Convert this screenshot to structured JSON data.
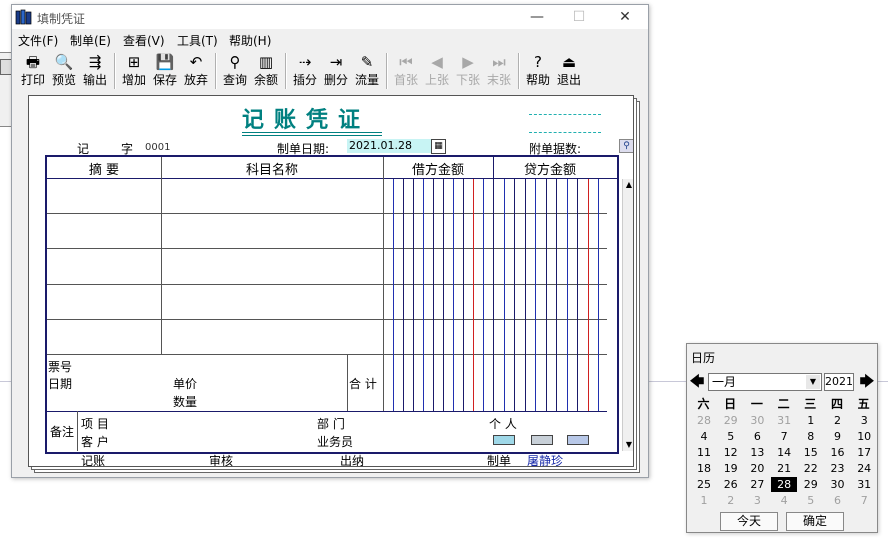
{
  "window": {
    "title": "填制凭证",
    "controls": {
      "minimize": "—",
      "maximize": "☐",
      "close": "✕"
    }
  },
  "menu": [
    "文件(F)",
    "制单(E)",
    "查看(V)",
    "工具(T)",
    "帮助(H)"
  ],
  "toolbar": [
    {
      "label": "打印",
      "icon": "printer-icon",
      "glyph": "🖶",
      "enabled": true
    },
    {
      "label": "预览",
      "icon": "preview-icon",
      "glyph": "🔍",
      "enabled": true
    },
    {
      "label": "输出",
      "icon": "export-icon",
      "glyph": "⇶",
      "enabled": true
    },
    {
      "label": "增加",
      "icon": "add-icon",
      "glyph": "⊞",
      "enabled": true
    },
    {
      "label": "保存",
      "icon": "save-icon",
      "glyph": "💾",
      "enabled": true
    },
    {
      "label": "放弃",
      "icon": "undo-icon",
      "glyph": "↶",
      "enabled": true
    },
    {
      "label": "查询",
      "icon": "binoculars-icon",
      "glyph": "⚲",
      "enabled": true
    },
    {
      "label": "余额",
      "icon": "balance-chart-icon",
      "glyph": "▥",
      "enabled": true
    },
    {
      "label": "插分",
      "icon": "insert-line-icon",
      "glyph": "⇢",
      "enabled": true
    },
    {
      "label": "删分",
      "icon": "delete-line-icon",
      "glyph": "⇥",
      "enabled": true
    },
    {
      "label": "流量",
      "icon": "cashflow-icon",
      "glyph": "✎",
      "enabled": true
    },
    {
      "label": "首张",
      "icon": "first-icon",
      "glyph": "⏮",
      "enabled": false
    },
    {
      "label": "上张",
      "icon": "prev-icon",
      "glyph": "◀",
      "enabled": false
    },
    {
      "label": "下张",
      "icon": "next-icon",
      "glyph": "▶",
      "enabled": false
    },
    {
      "label": "末张",
      "icon": "last-icon",
      "glyph": "⏭",
      "enabled": false
    },
    {
      "label": "帮助",
      "icon": "help-icon",
      "glyph": "?",
      "enabled": true
    },
    {
      "label": "退出",
      "icon": "exit-icon",
      "glyph": "⏏",
      "enabled": true
    }
  ],
  "voucher": {
    "title": "记账凭证",
    "type_label": "记",
    "number_label": "字",
    "number": "0001",
    "date_label": "制单日期:",
    "date": "2021.01.28",
    "attachments_label": "附单据数:",
    "headers": {
      "summary": "摘  要",
      "account": "科目名称",
      "debit": "借方金额",
      "credit": "贷方金额"
    },
    "bill_no_label": "票号",
    "date2_label": "日期",
    "unit_price_label": "单价",
    "quantity_label": "数量",
    "total_label": "合 计",
    "remarks_label": "备注",
    "project_label": "项  目",
    "customer_label": "客  户",
    "department_label": "部  门",
    "person_label": "个  人",
    "salesperson_label": "业务员",
    "signatures": {
      "bookkeeping_label": "记账",
      "review_label": "审核",
      "cashier_label": "出纳",
      "maker_label": "制单",
      "maker_name": "屠静珍"
    }
  },
  "calendar": {
    "title": "日历",
    "month": "一月",
    "year": "2021",
    "weekdays": [
      "六",
      "日",
      "一",
      "二",
      "三",
      "四",
      "五"
    ],
    "weeks": [
      [
        "28",
        "29",
        "30",
        "31",
        "1",
        "2",
        "3"
      ],
      [
        "4",
        "5",
        "6",
        "7",
        "8",
        "9",
        "10"
      ],
      [
        "11",
        "12",
        "13",
        "14",
        "15",
        "16",
        "17"
      ],
      [
        "18",
        "19",
        "20",
        "21",
        "22",
        "23",
        "24"
      ],
      [
        "25",
        "26",
        "27",
        "28",
        "29",
        "30",
        "31"
      ],
      [
        "1",
        "2",
        "3",
        "4",
        "5",
        "6",
        "7"
      ]
    ],
    "selected_day": "28",
    "today_label": "今天",
    "ok_label": "确定"
  }
}
